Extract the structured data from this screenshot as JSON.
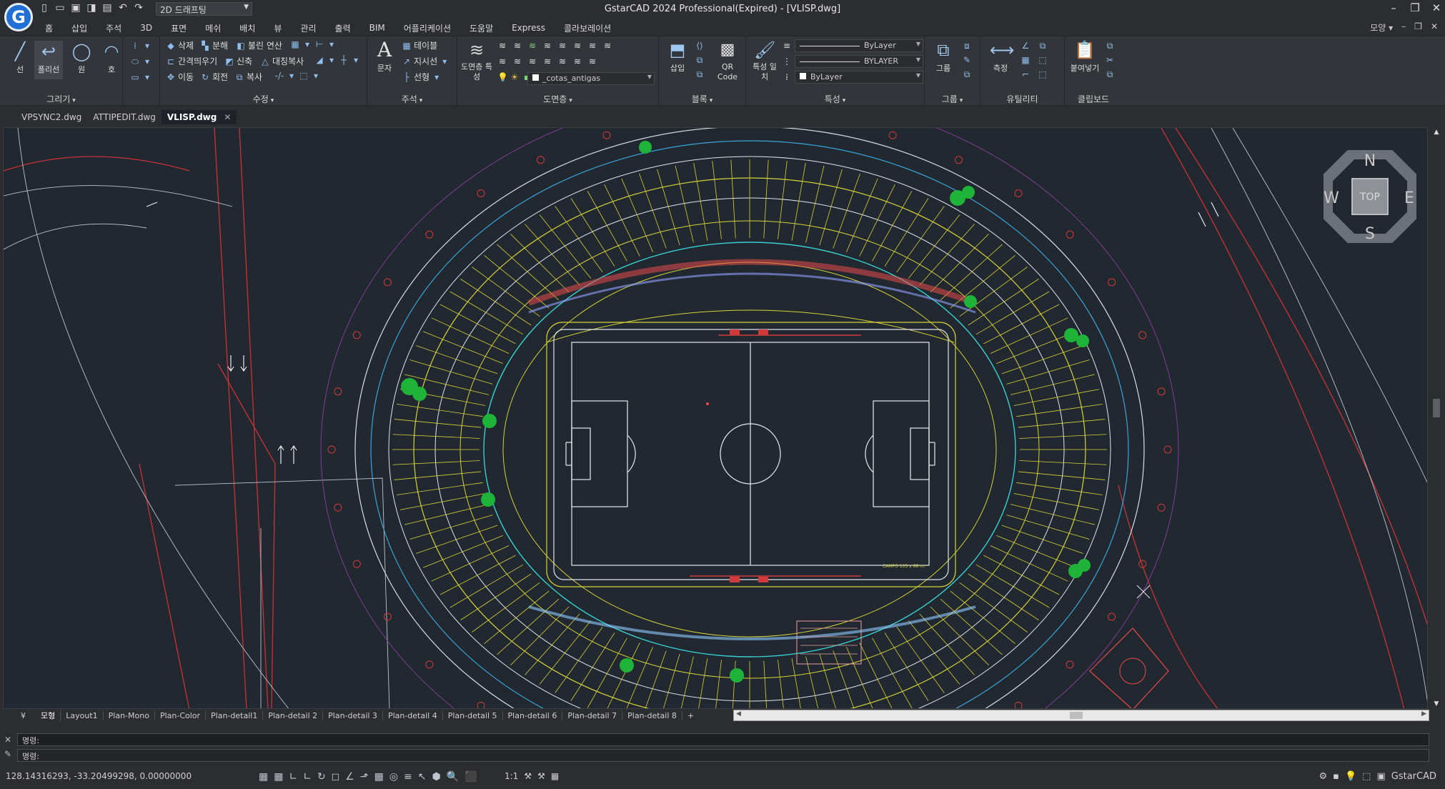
{
  "app": {
    "title": "GstarCAD 2024 Professional(Expired) - [VLISP.dwg]",
    "logo_letter": "G",
    "workspace": "2D 드래프팅"
  },
  "menu": [
    "홈",
    "삽입",
    "주석",
    "3D",
    "표면",
    "메쉬",
    "배치",
    "뷰",
    "관리",
    "출력",
    "BIM",
    "어플리케이션",
    "도움말",
    "Express",
    "콜라보레이션"
  ],
  "menu_right": "모양",
  "ribbon": {
    "draw": {
      "label": "그리기",
      "line": "선",
      "polyline": "폴리선",
      "circle": "원",
      "arc": "호"
    },
    "modify": {
      "label": "수정",
      "erase": "삭제",
      "explode": "분해",
      "boolean": "불린 연산",
      "offset": "간격띄우기",
      "stretch": "신축",
      "mirror": "대칭복사",
      "move": "이동",
      "rotate": "회전",
      "copy": "복사"
    },
    "annotation": {
      "label": "주석",
      "text": "문자",
      "table": "테이블",
      "leader": "지시선",
      "linear": "선형"
    },
    "layers": {
      "label": "도면층",
      "props": "도면층 특성",
      "current_layer": "_cotas_antigas"
    },
    "block": {
      "label": "블록",
      "insert": "삽입",
      "qr": "QR Code"
    },
    "properties": {
      "label": "특성",
      "match": "특성 일치",
      "color": "ByLayer",
      "linetype": "BYLAYER",
      "lineweight": "ByLayer"
    },
    "group": {
      "label": "그룹",
      "group": "그룹"
    },
    "utilities": {
      "label": "유틸리티",
      "measure": "측정"
    },
    "clipboard": {
      "label": "클립보드",
      "paste": "붙여넣기"
    }
  },
  "file_tabs": [
    "VPSYNC2.dwg",
    "ATTIPEDIT.dwg",
    "VLISP.dwg"
  ],
  "active_file": "VLISP.dwg",
  "layout_tabs": [
    "모형",
    "Layout1",
    "Plan-Mono",
    "Plan-Color",
    "Plan-detail1",
    "Plan-detail 2",
    "Plan-detail 3",
    "Plan-detail 4",
    "Plan-detail 5",
    "Plan-detail 6",
    "Plan-detail 7",
    "Plan-detail 8",
    "+"
  ],
  "viewcube": {
    "n": "N",
    "s": "S",
    "e": "E",
    "w": "W",
    "top": "TOP"
  },
  "drawing_labels": {
    "field_note": "CAMPO 105 x 68 m."
  },
  "command": {
    "prompt1": "명령:",
    "prompt2": "명령:"
  },
  "status": {
    "coordinates": "128.14316293, -33.20499298, 0.00000000",
    "scale": "1:1",
    "brand": "GstarCAD"
  }
}
